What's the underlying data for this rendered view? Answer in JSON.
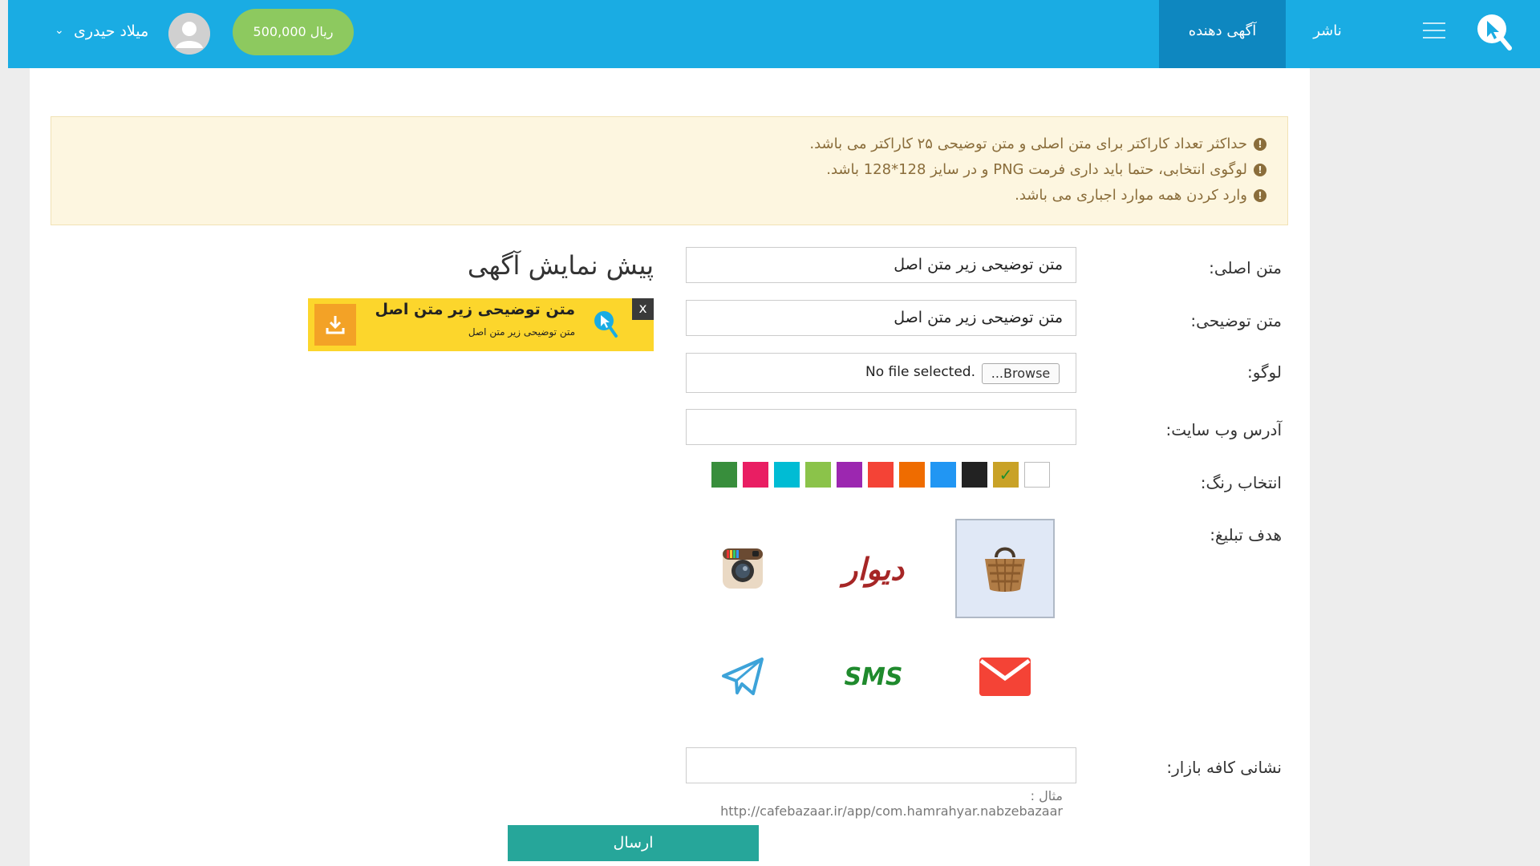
{
  "header": {
    "nav_advertiser": "آگهی دهنده",
    "nav_publisher": "ناشر",
    "balance": "500,000 ریال",
    "username": "میلاد حیدری",
    "caret": "⌄",
    "brand_color": "#1aace3"
  },
  "notice": {
    "items": [
      "حداکثر تعداد کاراکتر برای متن اصلی و متن توضیحی ۲۵ کاراکتر می باشد.",
      "لوگوی انتخابی، حتما باید داری فرمت PNG و در سایز 128*128 باشد.",
      "وارد کردن همه موارد اجباری می باشد."
    ],
    "icon": "!"
  },
  "form": {
    "main_text_label": "متن اصلی:",
    "main_text_value": "متن توضیحی زیر متن اصل",
    "desc_label": "متن توضیحی:",
    "desc_value": "متن توضیحی زیر متن اصل",
    "logo_label": "لوگو:",
    "browse_label": "...Browse",
    "no_file": "No file selected.",
    "website_label": "آدرس وب سایت:",
    "website_value": "",
    "color_label": "انتخاب رنگ:",
    "colors": [
      "#ffffff",
      "#c9a227",
      "#222222",
      "#2196f3",
      "#ef6c00",
      "#f44336",
      "#9c27b0",
      "#8bc34a",
      "#00bcd4",
      "#e91e63",
      "#388e3c"
    ],
    "selected_color": "#c9a227",
    "target_label": "هدف تبلیغ:",
    "targets": {
      "bazaar": "bazaar-basket-icon",
      "divar": "دیوار",
      "instagram": "instagram-icon",
      "email": "email-icon",
      "sms": "SMS",
      "telegram": "telegram-icon"
    },
    "cafebazaar_label": "نشانی کافه بازار:",
    "cafebazaar_value": "",
    "cafebazaar_hint": "مثال : http://cafebazaar.ir/app/com.hamrahyar.nabzebazaar",
    "submit": "ارسال"
  },
  "preview": {
    "title": "پیش نمایش آگهی",
    "banner_title": "متن توضیحی زیر متن اصل",
    "banner_subtitle": "متن توضیحی زیر متن اصل",
    "close": "x"
  }
}
